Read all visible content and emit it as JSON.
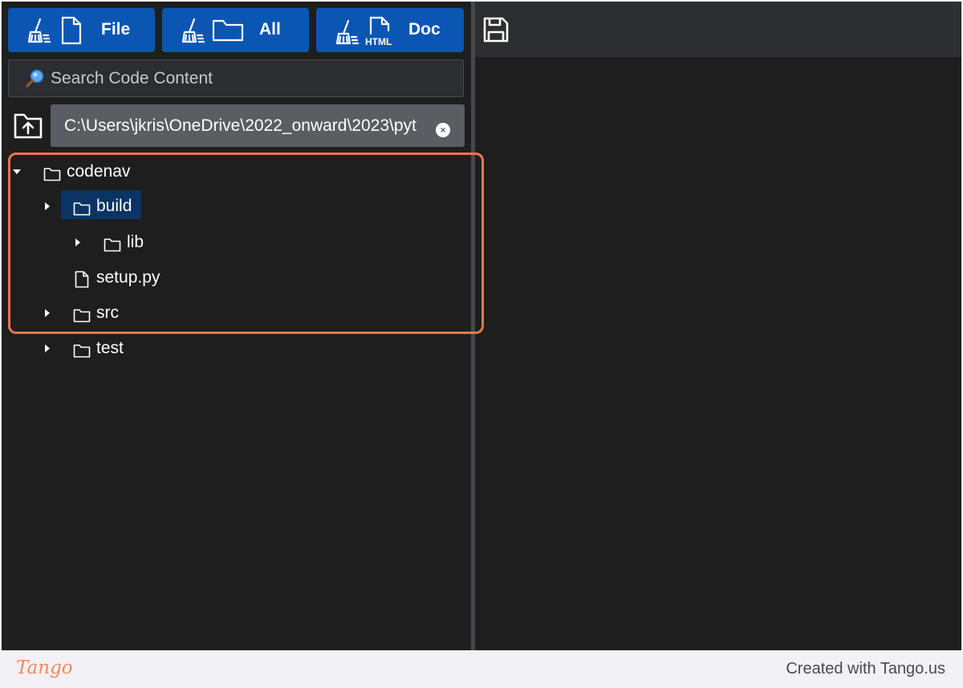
{
  "toolbar": {
    "file_label": "File",
    "all_label": "All",
    "doc_label": "Doc",
    "html_badge": "HTML"
  },
  "search": {
    "placeholder": "Search Code Content"
  },
  "path": {
    "value": "C:\\Users\\jkris\\OneDrive\\2022_onward\\2023\\pyt",
    "clear_symbol": "×"
  },
  "tree": {
    "codenav": "codenav",
    "build": "build",
    "lib": "lib",
    "setup": "setup.py",
    "src": "src",
    "test": "test"
  },
  "footer": {
    "logo": "Tango",
    "credit": "Created with Tango.us"
  },
  "colors": {
    "button_blue": "#0c56b3",
    "selection": "#0b3464",
    "highlight_orange": "#f2734b",
    "panel_bg": "#1e1e1e"
  },
  "icons": [
    "broom-icon",
    "file-icon",
    "folder-icon",
    "html-file-icon",
    "search-icon",
    "upload-folder-icon",
    "save-icon",
    "caret-down-icon",
    "caret-right-icon"
  ]
}
